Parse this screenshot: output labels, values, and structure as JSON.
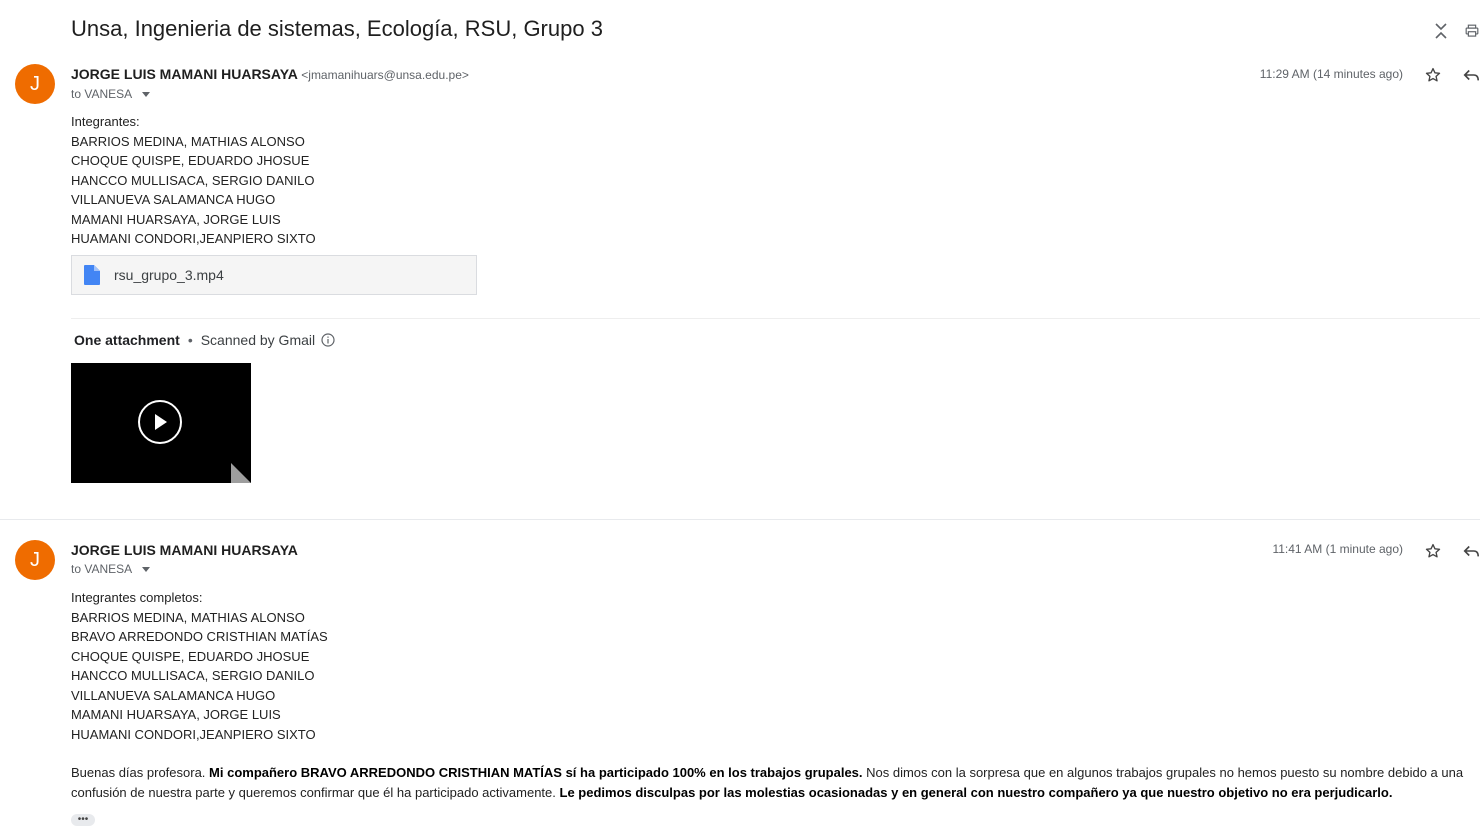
{
  "subject": "Unsa, Ingenieria de sistemas, Ecología, RSU, Grupo 3",
  "messages": [
    {
      "avatar_letter": "J",
      "sender_name": "JORGE LUIS MAMANI HUARSAYA",
      "sender_email": "<jmamanihuars@unsa.edu.pe>",
      "to_label": "to VANESA",
      "time": "11:29 AM (14 minutes ago)",
      "body_lines": [
        "Integrantes:",
        "BARRIOS MEDINA, MATHIAS ALONSO",
        "CHOQUE QUISPE, EDUARDO JHOSUE",
        "HANCCO MULLISACA, SERGIO DANILO",
        "VILLANUEVA SALAMANCA HUGO",
        "MAMANI HUARSAYA, JORGE LUIS",
        "HUAMANI CONDORI,JEANPIERO SIXTO"
      ],
      "attachment_chip": "rsu_grupo_3.mp4",
      "attachments_count_label": "One attachment",
      "scanned_label": "Scanned by Gmail"
    },
    {
      "avatar_letter": "J",
      "sender_name": "JORGE LUIS MAMANI HUARSAYA",
      "to_label": "to VANESA",
      "time": "11:41 AM (1 minute ago)",
      "body_lines": [
        "Integrantes completos:",
        "BARRIOS MEDINA, MATHIAS ALONSO",
        "BRAVO ARREDONDO CRISTHIAN MATÍAS",
        "CHOQUE QUISPE, EDUARDO JHOSUE",
        "HANCCO MULLISACA, SERGIO DANILO",
        "VILLANUEVA SALAMANCA HUGO",
        "MAMANI HUARSAYA, JORGE LUIS",
        "HUAMANI CONDORI,JEANPIERO SIXTO"
      ],
      "paragraph": {
        "p1": "Buenas días profesora. ",
        "b1": "Mi compañero BRAVO ARREDONDO CRISTHIAN MATÍAS sí ha participado 100% en los trabajos grupales.",
        "p2": " Nos dimos con la sorpresa que en algunos trabajos grupales no hemos puesto su nombre debido a una confusión de nuestra parte y queremos confirmar que él ha participado activamente. ",
        "b2": "Le pedimos disculpas por las molestias ocasionadas y en general con nuestro compañero ya que nuestro objetivo no era perjudicarlo."
      }
    }
  ],
  "colors": {
    "avatar": "#ef6c00",
    "file_icon": "#4285f4"
  },
  "icons": [
    "collapse-icon",
    "print-icon",
    "star-icon",
    "reply-icon",
    "file-icon",
    "info-icon",
    "play-icon",
    "more-icon"
  ]
}
